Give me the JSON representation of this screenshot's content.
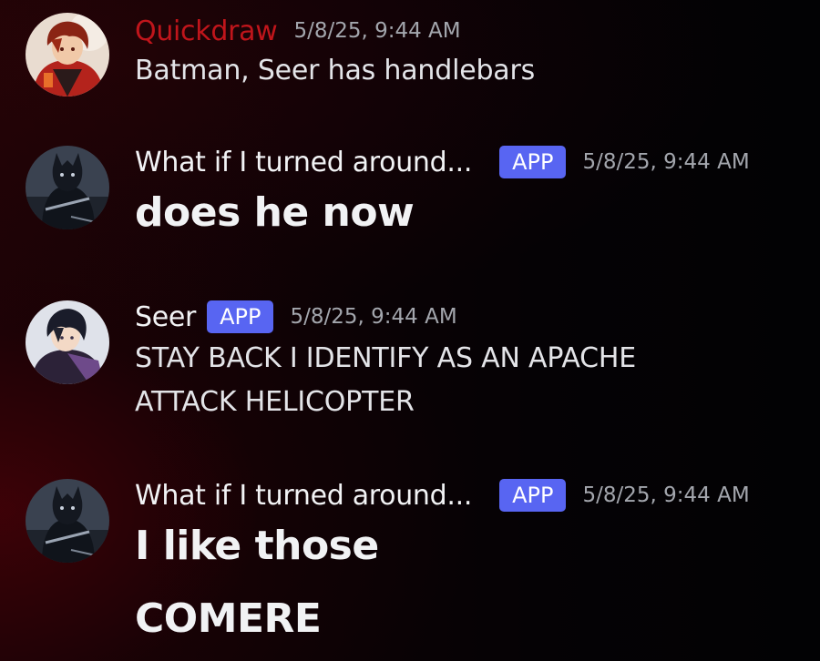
{
  "messages": [
    {
      "username": "Quickdraw",
      "username_color": "#c0151b",
      "badge": "",
      "timestamp": "5/8/25, 9:44 AM",
      "lines": [
        "Batman, Seer has handlebars"
      ],
      "avatar_icon": "anime-boy-red-jacket-avatar"
    },
    {
      "username": "What if I turned around...",
      "username_color": "#f2f3f5",
      "badge": "APP",
      "timestamp": "5/8/25, 9:44 AM",
      "lines": [
        "does he now"
      ],
      "avatar_icon": "dark-knight-avatar"
    },
    {
      "username": "Seer",
      "username_color": "#f2f3f5",
      "badge": "APP",
      "timestamp": "5/8/25, 9:44 AM",
      "lines": [
        "STAY BACK I IDENTIFY AS AN APACHE",
        "ATTACK HELICOPTER"
      ],
      "avatar_icon": "anime-boy-dark-hair-avatar"
    },
    {
      "username": "What if I turned around...",
      "username_color": "#f2f3f5",
      "badge": "APP",
      "timestamp": "5/8/25, 9:44 AM",
      "lines": [
        "I like those",
        "COMERE"
      ],
      "avatar_icon": "dark-knight-avatar"
    }
  ],
  "colors": {
    "badge_bg": "#5865f2",
    "timestamp": "#a3a6ad",
    "message_text": "#e3e4e8"
  }
}
